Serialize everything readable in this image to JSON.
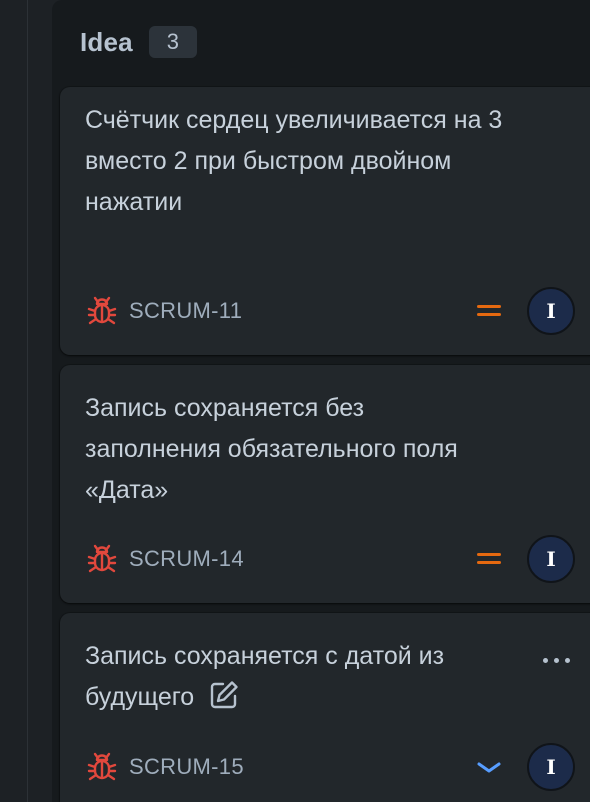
{
  "column": {
    "title": "Idea",
    "count": "3"
  },
  "cards": [
    {
      "title": "Счётчик сердец увеличивается на 3 вместо 2 при быстром двойном нажатии",
      "key": "SCRUM-11",
      "type_icon": "bug-icon",
      "priority": "medium",
      "priority_icon": "priority-medium-icon",
      "assignee_initial": "I"
    },
    {
      "title": "Запись сохраняется без заполнения обязательного поля «Дата»",
      "key": "SCRUM-14",
      "type_icon": "bug-icon",
      "priority": "medium",
      "priority_icon": "priority-medium-icon",
      "assignee_initial": "I"
    },
    {
      "title": "Запись сохраняется с датой из будущего",
      "key": "SCRUM-15",
      "type_icon": "bug-icon",
      "priority": "low",
      "priority_icon": "priority-low-icon",
      "assignee_initial": "I",
      "edit_icon": "pencil-edit-icon",
      "more_icon": "more-actions-icon"
    }
  ],
  "colors": {
    "bug": "#e2483d",
    "priority_medium": "#e56910",
    "priority_low": "#579dff",
    "avatar_bg": "#1c2b4a"
  }
}
